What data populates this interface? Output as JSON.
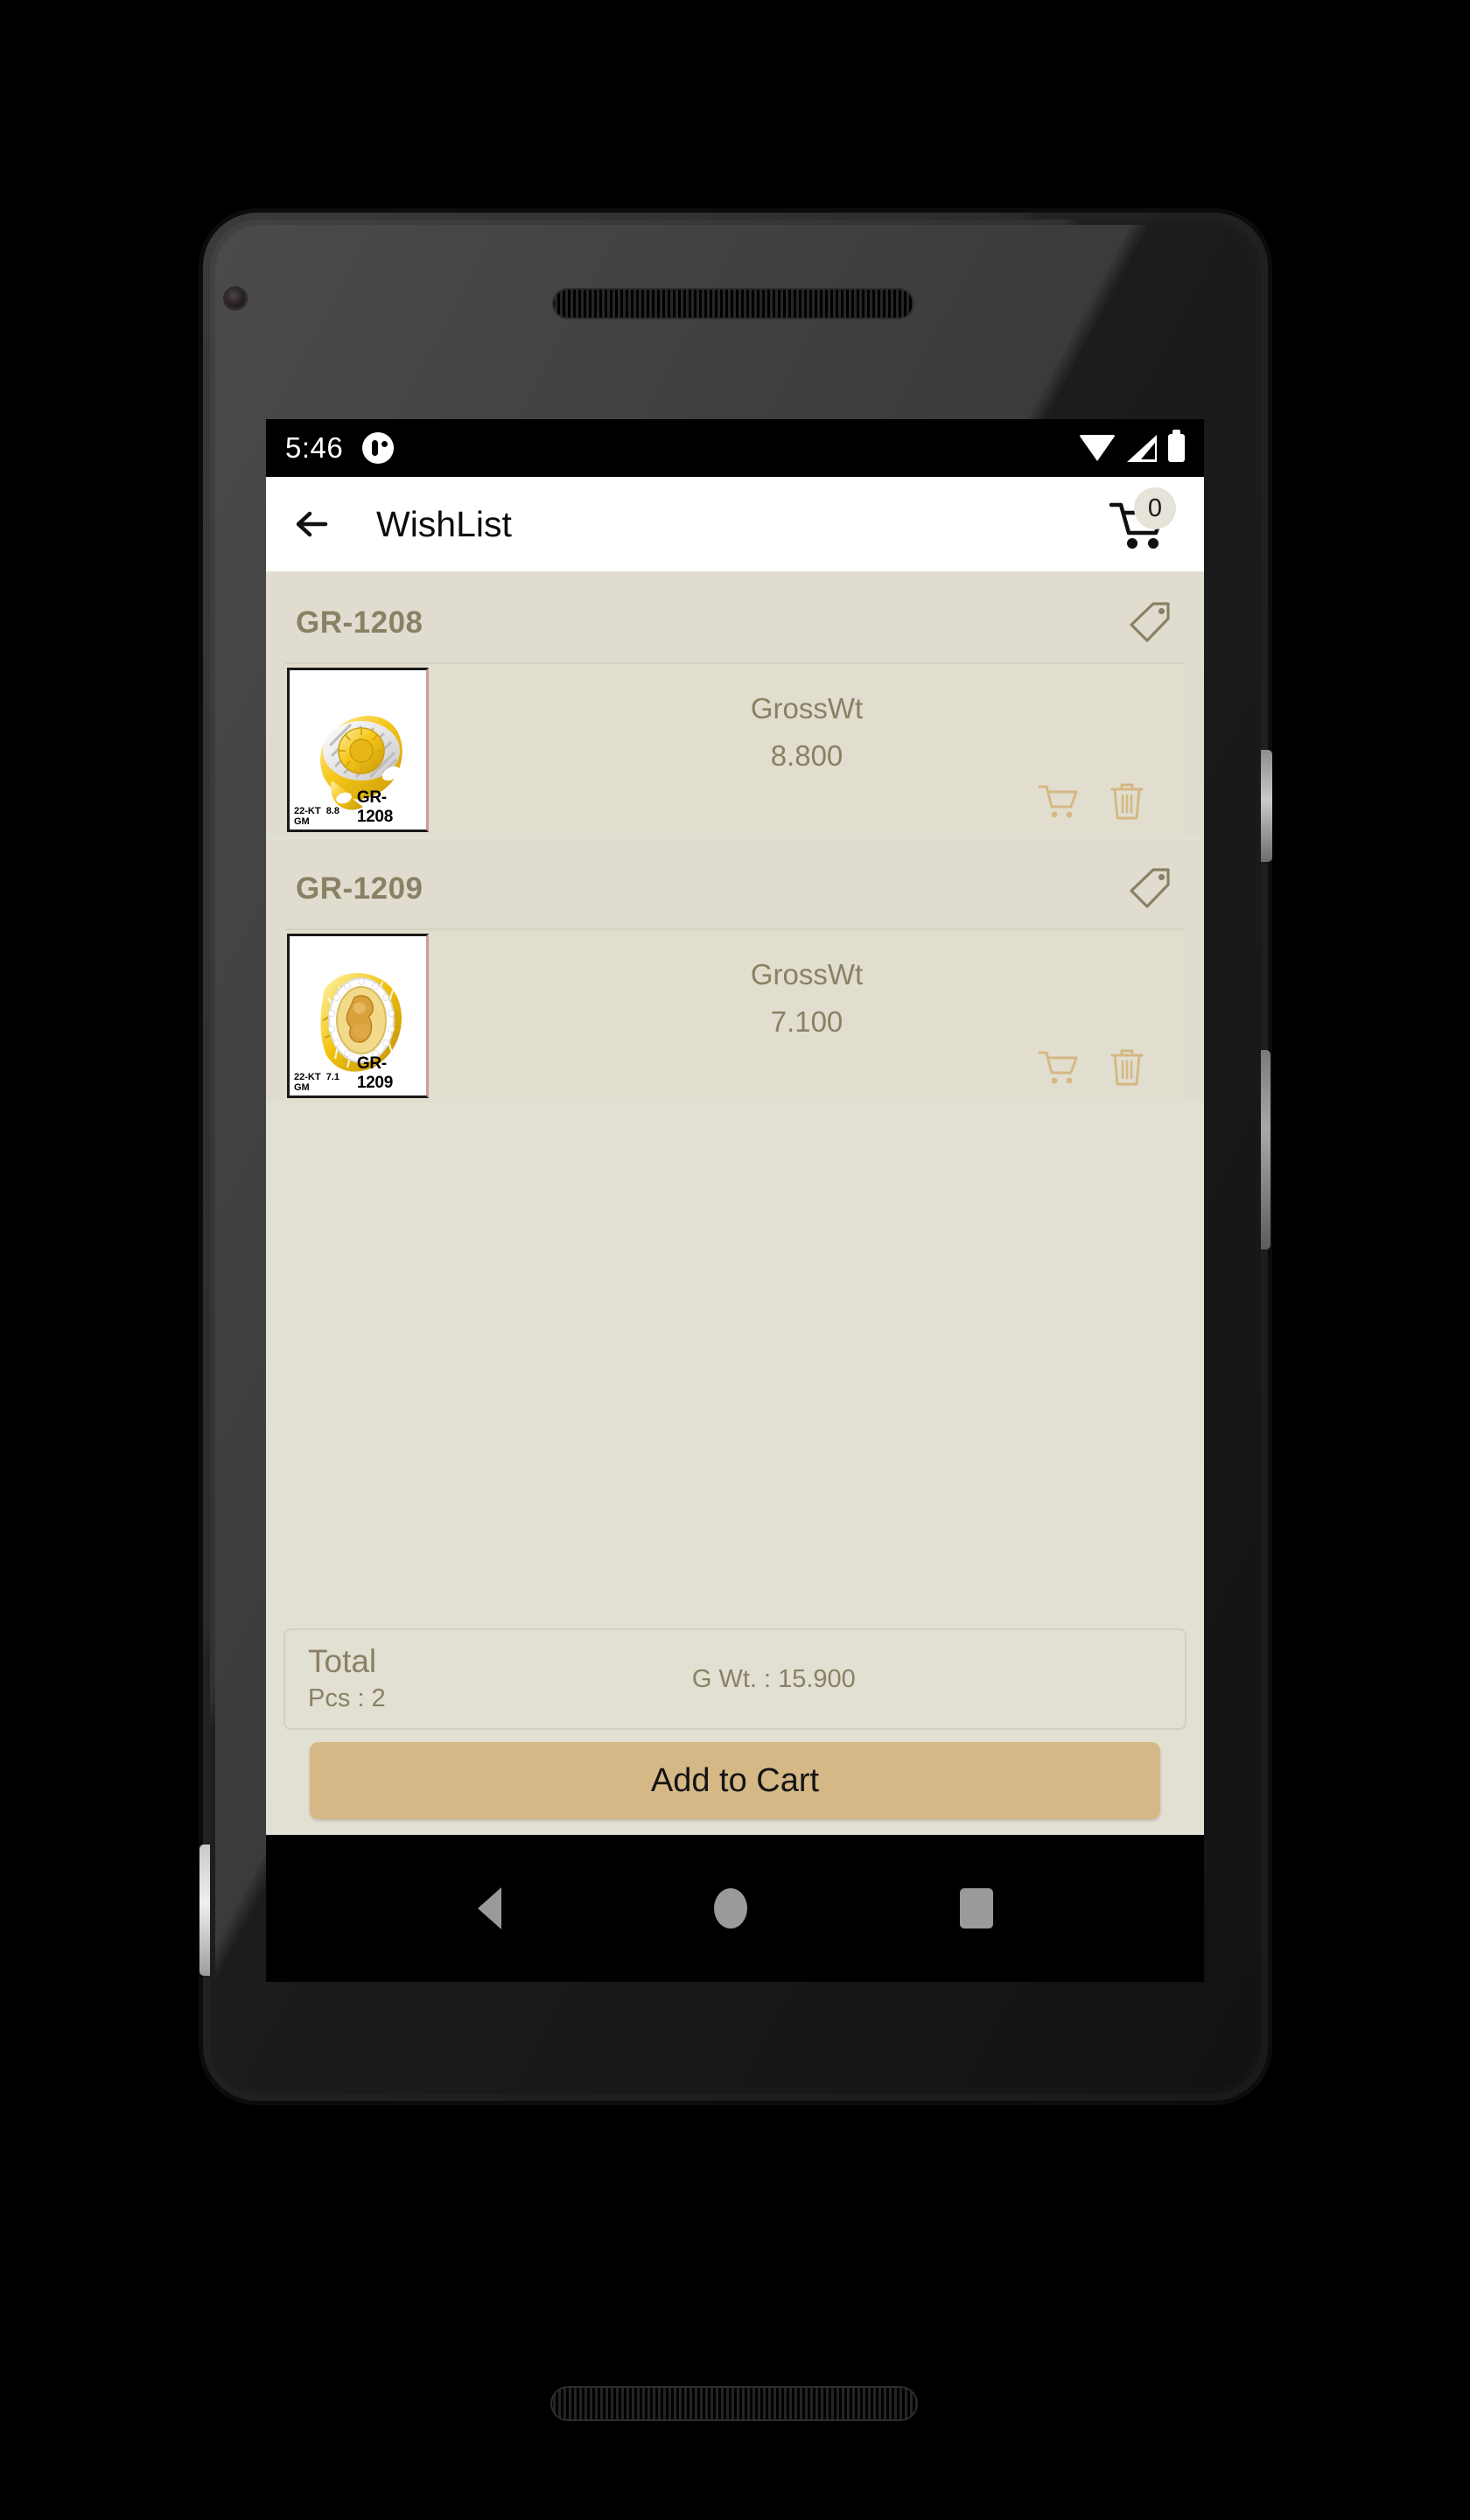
{
  "device": {
    "front_camera": "front-camera",
    "earpiece": "earpiece-speaker",
    "bottom_speaker": "bottom-speaker",
    "power_button": "power-button",
    "volume_button": "volume-rocker"
  },
  "status_bar": {
    "time": "5:46",
    "notification_icon": "app-notification-icon",
    "wifi_icon": "wifi-icon",
    "signal_icon": "cell-signal-icon",
    "battery_icon": "battery-icon"
  },
  "app_bar": {
    "back_icon": "back-arrow-icon",
    "title": "WishList",
    "cart_icon": "shopping-cart-icon",
    "cart_count": "0"
  },
  "items": [
    {
      "code": "GR-1208",
      "tag_icon": "price-tag-icon",
      "gross_wt_label": "GrossWt",
      "gross_wt_value": "8.800",
      "thumb_karat": "22-KT",
      "thumb_weight": "8.8 GM",
      "thumb_code": "GR-1208",
      "cart_icon": "add-to-cart-icon",
      "delete_icon": "delete-icon"
    },
    {
      "code": "GR-1209",
      "tag_icon": "price-tag-icon",
      "gross_wt_label": "GrossWt",
      "gross_wt_value": "7.100",
      "thumb_karat": "22-KT",
      "thumb_weight": "7.1 GM",
      "thumb_code": "GR-1209",
      "cart_icon": "add-to-cart-icon",
      "delete_icon": "delete-icon"
    }
  ],
  "totals": {
    "title": "Total",
    "pieces": "Pcs : 2",
    "gross_weight": "G Wt. : 15.900"
  },
  "cta": {
    "label": "Add to Cart"
  },
  "nav_bar": {
    "back": "nav-back-icon",
    "home": "nav-home-icon",
    "recents": "nav-recents-icon"
  },
  "colors": {
    "accent_gold": "#d5b885",
    "text_olive": "#8a8164",
    "card_bg": "#e0ddd0",
    "body_bg": "#e2dfd3"
  }
}
